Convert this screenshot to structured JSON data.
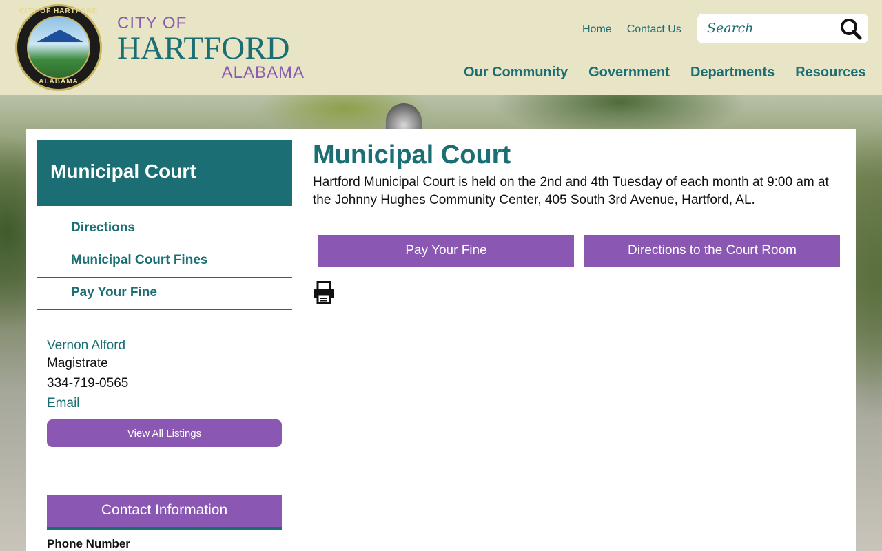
{
  "header": {
    "seal": {
      "top_text": "CITY OF HARTFORD",
      "bottom_text": "ALABAMA"
    },
    "brand": {
      "city_of": "CITY OF",
      "name": "HARTFORD",
      "state": "ALABAMA"
    },
    "util_links": [
      {
        "label": "Home"
      },
      {
        "label": "Contact Us"
      }
    ],
    "search": {
      "placeholder": "Search",
      "icon": "search-icon"
    },
    "main_nav": [
      {
        "label": "Our Community"
      },
      {
        "label": "Government"
      },
      {
        "label": "Departments"
      },
      {
        "label": "Resources"
      }
    ]
  },
  "sidebar": {
    "title": "Municipal Court",
    "menu": [
      {
        "label": "Directions"
      },
      {
        "label": "Municipal Court Fines"
      },
      {
        "label": "Pay Your Fine"
      }
    ],
    "contact": {
      "name": "Vernon Alford",
      "title": "Magistrate",
      "phone": "334-719-0565",
      "email_label": "Email"
    },
    "view_all_label": "View All Listings",
    "contact_info_title": "Contact Information",
    "phone_number_label": "Phone Number"
  },
  "main": {
    "title": "Municipal Court",
    "description": "Hartford Municipal Court is held on the 2nd and 4th Tuesday of each month at 9:00 am at the Johnny Hughes Community Center, 405 South 3rd Avenue, Hartford, AL.",
    "buttons": [
      {
        "label": "Pay Your Fine"
      },
      {
        "label": "Directions to the Court Room"
      }
    ],
    "print_icon": "printer-icon"
  },
  "colors": {
    "header_bg": "#e8e4c6",
    "teal": "#1a6e74",
    "purple": "#8a57b2"
  }
}
